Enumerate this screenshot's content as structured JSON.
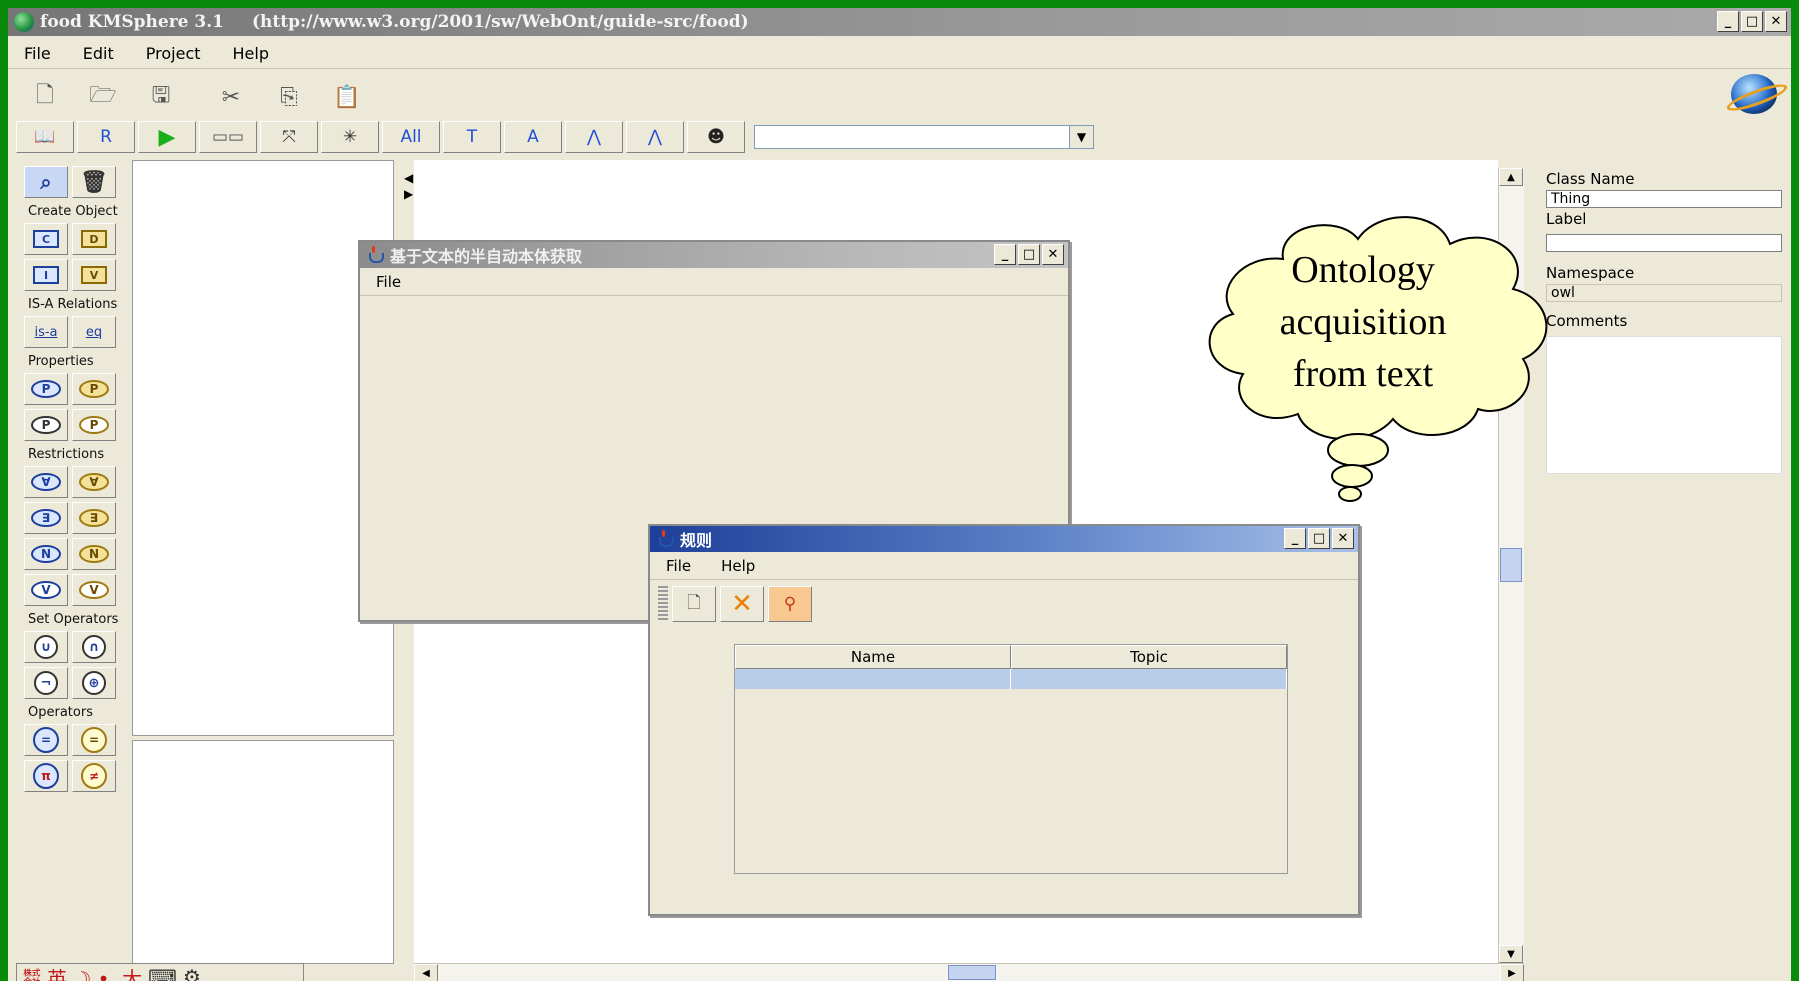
{
  "window": {
    "app_title": "food  KMSphere 3.1",
    "url": "(http://www.w3.org/2001/sw/WebOnt/guide-src/food)",
    "min": "_",
    "max": "□",
    "close": "✕"
  },
  "menubar": [
    {
      "label": "File"
    },
    {
      "label": "Edit"
    },
    {
      "label": "Project"
    },
    {
      "label": "Help"
    }
  ],
  "toolbar1": [
    {
      "icon": "new-file-icon",
      "glyph": "🗋"
    },
    {
      "icon": "open-folder-icon",
      "glyph": "🗁"
    },
    {
      "icon": "save-icon",
      "glyph": "🖫"
    },
    {
      "icon": "cut-icon",
      "glyph": "✂"
    },
    {
      "icon": "copy-icon",
      "glyph": "⎘"
    },
    {
      "icon": "paste-icon",
      "glyph": "📋"
    }
  ],
  "toolbar2": {
    "buttons": [
      {
        "name": "ontology-book-button",
        "text": "📖"
      },
      {
        "name": "rules-button",
        "text": "R"
      },
      {
        "name": "run-button",
        "text": "▶"
      },
      {
        "name": "layout-button",
        "text": "▭▭"
      },
      {
        "name": "fit-button",
        "text": "⤧"
      },
      {
        "name": "expand-button",
        "text": "✳"
      },
      {
        "name": "all-button",
        "text": "All"
      },
      {
        "name": "text-button",
        "text": "T"
      },
      {
        "name": "annotation-button",
        "text": "A"
      },
      {
        "name": "tree-button",
        "text": "⋀"
      },
      {
        "name": "tree2-button",
        "text": "⋀"
      },
      {
        "name": "reasoner-button",
        "text": "☻"
      }
    ],
    "combo_value": ""
  },
  "palette": {
    "sections": [
      {
        "label": "Create Object",
        "rows": [
          [
            "C",
            "D"
          ],
          [
            "I",
            "V"
          ]
        ]
      },
      {
        "label": "IS-A Relations",
        "rows": [
          [
            "is-a",
            "eq"
          ]
        ]
      },
      {
        "label": "Properties",
        "rows": [
          [
            "P",
            "P"
          ],
          [
            "P",
            "P"
          ]
        ]
      },
      {
        "label": "Restrictions",
        "rows": [
          [
            "∀",
            "∀"
          ],
          [
            "∃",
            "∃"
          ],
          [
            "N",
            "N"
          ],
          [
            "V",
            "V"
          ]
        ]
      },
      {
        "label": "Set Operators",
        "rows": [
          [
            "∪",
            "∩"
          ],
          [
            "¬",
            "⊕"
          ]
        ]
      },
      {
        "label": "Operators",
        "rows": [
          [
            "=",
            "="
          ],
          [
            "π",
            "≠"
          ]
        ]
      }
    ]
  },
  "properties": {
    "class_name_label": "Class Name",
    "class_name_value": "Thing",
    "label_label": "Label",
    "label_value": "",
    "namespace_label": "Namespace",
    "namespace_value": "owl",
    "comments_label": "Comments"
  },
  "win_text": {
    "title": "基于文本的半自动本体获取",
    "menu_file": "File"
  },
  "win_rule": {
    "title": "规则",
    "menu_file": "File",
    "menu_help": "Help",
    "columns": [
      "Name",
      "Topic"
    ]
  },
  "callout": {
    "lines": [
      "Ontology",
      "acquisition",
      "from text"
    ]
  },
  "ime": {
    "text": "英 ☽ •, 大"
  },
  "colors": {
    "frame_green": "#0a8a0a",
    "face": "#ece9d8",
    "cloud_fill": "#ffffc8",
    "rule_title_blue": "#2a4fa8"
  }
}
